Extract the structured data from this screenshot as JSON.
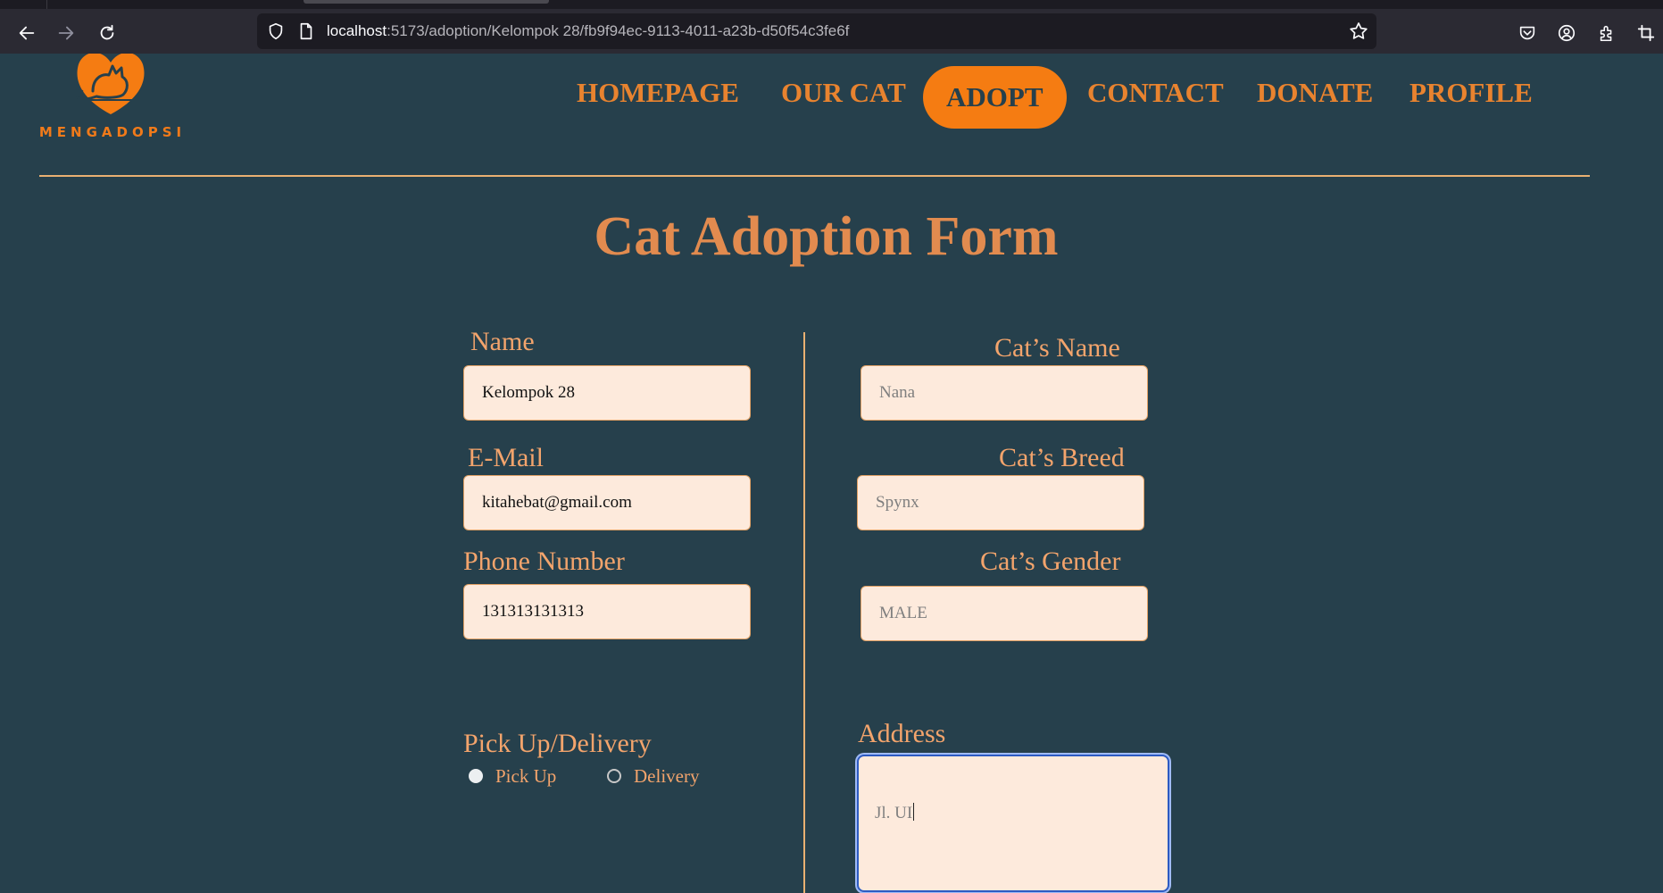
{
  "browser": {
    "url_host": "localhost",
    "url_path": ":5173/adoption/Kelompok 28/fb9f94ec-9113-4011-a23b-d50f54c3fe6f"
  },
  "site": {
    "logo_text": "MENGADOPSI",
    "brand_color": "#f57c12",
    "background_color": "#26404c"
  },
  "nav": {
    "items": [
      {
        "label": "HOMEPAGE"
      },
      {
        "label": "OUR CAT"
      },
      {
        "label": "ADOPT"
      },
      {
        "label": "CONTACT"
      },
      {
        "label": "DONATE"
      },
      {
        "label": "PROFILE"
      }
    ],
    "active": "ADOPT"
  },
  "form": {
    "title": "Cat Adoption Form",
    "left": {
      "name_label": "Name",
      "name_value": "Kelompok 28",
      "email_label": "E-Mail",
      "email_value": "kitahebat@gmail.com",
      "phone_label": "Phone Number",
      "phone_value": "131313131313",
      "pickup_label": "Pick Up/Delivery",
      "pickup_options": [
        "Pick Up",
        "Delivery"
      ],
      "pickup_selected": "Pick Up"
    },
    "right": {
      "cat_name_label": "Cat’s Name",
      "cat_name_placeholder": "Nana",
      "cat_breed_label": "Cat’s Breed",
      "cat_breed_placeholder": "Spynx",
      "cat_gender_label": "Cat’s Gender",
      "cat_gender_placeholder": "MALE",
      "address_label": "Address",
      "address_value": "Jl. UI"
    }
  }
}
